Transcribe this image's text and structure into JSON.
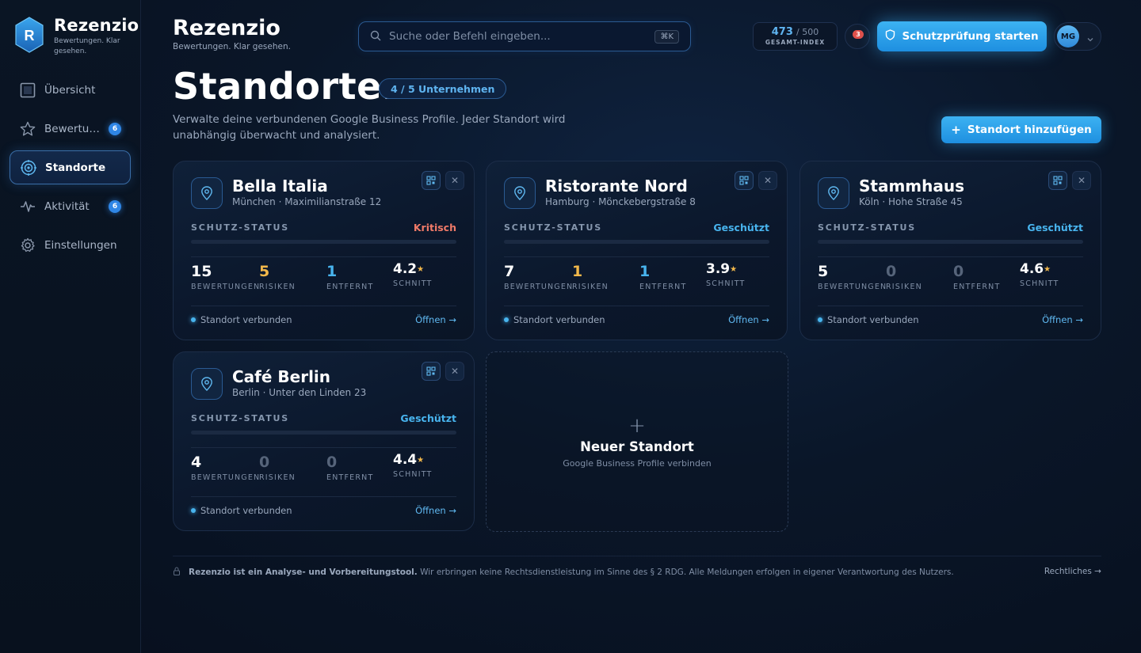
{
  "app": {
    "name": "Rezenzio",
    "tagline": "Bewertungen. Klar gesehen.",
    "logo_letter": "R"
  },
  "sidebar": {
    "items": [
      {
        "label": "Übersicht",
        "icon": "dashboard-icon",
        "badge": null,
        "active": false
      },
      {
        "label": "Bewertu…",
        "icon": "star-icon",
        "badge": "6",
        "active": false
      },
      {
        "label": "Standorte",
        "icon": "location-target-icon",
        "badge": null,
        "active": true
      },
      {
        "label": "Aktivität",
        "icon": "activity-icon",
        "badge": "6",
        "active": false
      },
      {
        "label": "Einstellungen",
        "icon": "gear-icon",
        "badge": null,
        "active": false
      }
    ]
  },
  "header": {
    "search_placeholder": "Suche oder Befehl eingeben...",
    "search_shortcut": "⌘K",
    "index_value": "473",
    "index_max": "/ 500",
    "index_label": "GESAMT-INDEX",
    "notification_count": "3",
    "cta_label": "Schutzprüfung starten",
    "user_initials": "MG"
  },
  "page": {
    "title": "Standorte.",
    "count_badge": "4 / 5 Unternehmen",
    "description": "Verwalte deine verbundenen Google Business Profile. Jeder Standort wird unabhängig überwacht und analysiert.",
    "add_button": "Standort hinzufügen"
  },
  "labels": {
    "status": "SCHUTZ-STATUS",
    "reviews": "BEWERTUNGEN",
    "risks": "RISIKEN",
    "removed": "ENTFERNT",
    "avg": "SCHNITT",
    "connected": "Standort verbunden",
    "open": "Öffnen →"
  },
  "locations": [
    {
      "name": "Bella Italia",
      "address": "München · Maximilianstraße 12",
      "status": "Kritisch",
      "reviews": "15",
      "risks": "5",
      "removed": "1",
      "rating": "4.2"
    },
    {
      "name": "Ristorante Nord",
      "address": "Hamburg · Mönckebergstraße 8",
      "status": "Geschützt",
      "reviews": "7",
      "risks": "1",
      "removed": "1",
      "rating": "3.9"
    },
    {
      "name": "Stammhaus",
      "address": "Köln · Hohe Straße 45",
      "status": "Geschützt",
      "reviews": "5",
      "risks": "0",
      "removed": "0",
      "rating": "4.6"
    },
    {
      "name": "Café Berlin",
      "address": "Berlin · Unter den Linden 23",
      "status": "Geschützt",
      "reviews": "4",
      "risks": "0",
      "removed": "0",
      "rating": "4.4"
    }
  ],
  "new_location": {
    "title": "Neuer Standort",
    "subtitle": "Google Business Profile verbinden"
  },
  "footer": {
    "bold": "Rezenzio ist ein Analyse- und Vorbereitungstool.",
    "text": "Wir erbringen keine Rechtsdienstleistung im Sinne des § 2 RDG. Alle Meldungen erfolgen in eigener Verantwortung des Nutzers.",
    "legal_link": "Rechtliches →"
  },
  "colors": {
    "accent": "#3cb2f2",
    "critical": "#f07a68",
    "protected": "#48b4ee",
    "amber": "#f2b84b"
  }
}
